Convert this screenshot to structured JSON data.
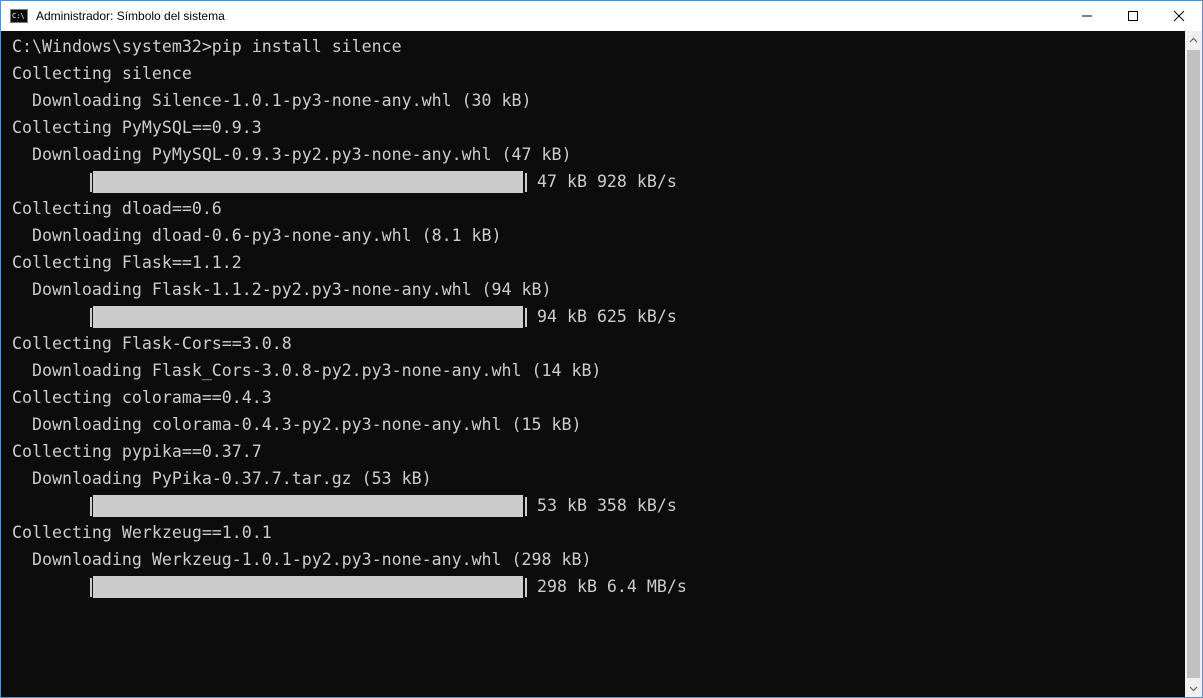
{
  "window": {
    "title": "Administrador: Símbolo del sistema",
    "app_icon_text": "C:\\",
    "icons": {
      "app": "cmd-icon",
      "minimize": "minimize-icon",
      "maximize": "maximize-icon",
      "close": "close-icon"
    }
  },
  "console": {
    "lines": [
      {
        "type": "text",
        "text": "C:\\Windows\\system32>pip install silence"
      },
      {
        "type": "text",
        "text": "Collecting silence"
      },
      {
        "type": "text",
        "text": "  Downloading Silence-1.0.1-py3-none-any.whl (30 kB)"
      },
      {
        "type": "text",
        "text": "Collecting PyMySQL==0.9.3"
      },
      {
        "type": "text",
        "text": "  Downloading PyMySQL-0.9.3-py2.py3-none-any.whl (47 kB)"
      },
      {
        "type": "progress",
        "fraction": 1.0,
        "text": "47 kB 928 kB/s"
      },
      {
        "type": "text",
        "text": "Collecting dload==0.6"
      },
      {
        "type": "text",
        "text": "  Downloading dload-0.6-py3-none-any.whl (8.1 kB)"
      },
      {
        "type": "text",
        "text": "Collecting Flask==1.1.2"
      },
      {
        "type": "text",
        "text": "  Downloading Flask-1.1.2-py2.py3-none-any.whl (94 kB)"
      },
      {
        "type": "progress",
        "fraction": 1.0,
        "text": "94 kB 625 kB/s"
      },
      {
        "type": "text",
        "text": "Collecting Flask-Cors==3.0.8"
      },
      {
        "type": "text",
        "text": "  Downloading Flask_Cors-3.0.8-py2.py3-none-any.whl (14 kB)"
      },
      {
        "type": "text",
        "text": "Collecting colorama==0.4.3"
      },
      {
        "type": "text",
        "text": "  Downloading colorama-0.4.3-py2.py3-none-any.whl (15 kB)"
      },
      {
        "type": "text",
        "text": "Collecting pypika==0.37.7"
      },
      {
        "type": "text",
        "text": "  Downloading PyPika-0.37.7.tar.gz (53 kB)"
      },
      {
        "type": "progress",
        "fraction": 1.0,
        "text": "53 kB 358 kB/s"
      },
      {
        "type": "text",
        "text": "Collecting Werkzeug==1.0.1"
      },
      {
        "type": "text",
        "text": "  Downloading Werkzeug-1.0.1-py2.py3-none-any.whl (298 kB)"
      },
      {
        "type": "progress",
        "fraction": 1.0,
        "text": "298 kB 6.4 MB/s"
      }
    ]
  },
  "scrollbar": {
    "up_icon": "scroll-up-arrow-icon",
    "down_icon": "scroll-down-arrow-icon"
  },
  "colors": {
    "console_bg": "#0c0c0c",
    "console_fg": "#cccccc",
    "titlebar_bg": "#ffffff",
    "scrollbar_bg": "#f0f0f0",
    "scrollbar_thumb": "#c1c1c1"
  }
}
